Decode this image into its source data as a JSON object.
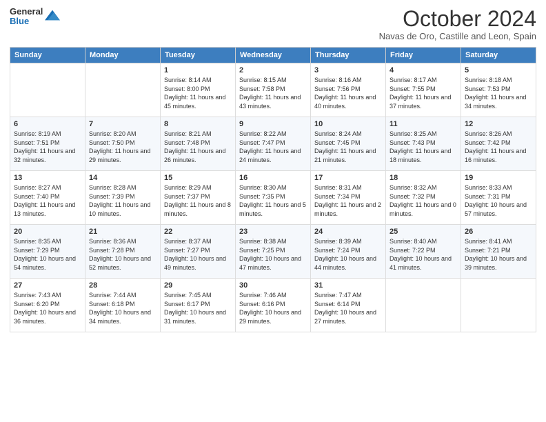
{
  "logo": {
    "general": "General",
    "blue": "Blue"
  },
  "header": {
    "month": "October 2024",
    "location": "Navas de Oro, Castille and Leon, Spain"
  },
  "weekdays": [
    "Sunday",
    "Monday",
    "Tuesday",
    "Wednesday",
    "Thursday",
    "Friday",
    "Saturday"
  ],
  "weeks": [
    [
      {
        "day": "",
        "content": ""
      },
      {
        "day": "",
        "content": ""
      },
      {
        "day": "1",
        "content": "Sunrise: 8:14 AM\nSunset: 8:00 PM\nDaylight: 11 hours and 45 minutes."
      },
      {
        "day": "2",
        "content": "Sunrise: 8:15 AM\nSunset: 7:58 PM\nDaylight: 11 hours and 43 minutes."
      },
      {
        "day": "3",
        "content": "Sunrise: 8:16 AM\nSunset: 7:56 PM\nDaylight: 11 hours and 40 minutes."
      },
      {
        "day": "4",
        "content": "Sunrise: 8:17 AM\nSunset: 7:55 PM\nDaylight: 11 hours and 37 minutes."
      },
      {
        "day": "5",
        "content": "Sunrise: 8:18 AM\nSunset: 7:53 PM\nDaylight: 11 hours and 34 minutes."
      }
    ],
    [
      {
        "day": "6",
        "content": "Sunrise: 8:19 AM\nSunset: 7:51 PM\nDaylight: 11 hours and 32 minutes."
      },
      {
        "day": "7",
        "content": "Sunrise: 8:20 AM\nSunset: 7:50 PM\nDaylight: 11 hours and 29 minutes."
      },
      {
        "day": "8",
        "content": "Sunrise: 8:21 AM\nSunset: 7:48 PM\nDaylight: 11 hours and 26 minutes."
      },
      {
        "day": "9",
        "content": "Sunrise: 8:22 AM\nSunset: 7:47 PM\nDaylight: 11 hours and 24 minutes."
      },
      {
        "day": "10",
        "content": "Sunrise: 8:24 AM\nSunset: 7:45 PM\nDaylight: 11 hours and 21 minutes."
      },
      {
        "day": "11",
        "content": "Sunrise: 8:25 AM\nSunset: 7:43 PM\nDaylight: 11 hours and 18 minutes."
      },
      {
        "day": "12",
        "content": "Sunrise: 8:26 AM\nSunset: 7:42 PM\nDaylight: 11 hours and 16 minutes."
      }
    ],
    [
      {
        "day": "13",
        "content": "Sunrise: 8:27 AM\nSunset: 7:40 PM\nDaylight: 11 hours and 13 minutes."
      },
      {
        "day": "14",
        "content": "Sunrise: 8:28 AM\nSunset: 7:39 PM\nDaylight: 11 hours and 10 minutes."
      },
      {
        "day": "15",
        "content": "Sunrise: 8:29 AM\nSunset: 7:37 PM\nDaylight: 11 hours and 8 minutes."
      },
      {
        "day": "16",
        "content": "Sunrise: 8:30 AM\nSunset: 7:35 PM\nDaylight: 11 hours and 5 minutes."
      },
      {
        "day": "17",
        "content": "Sunrise: 8:31 AM\nSunset: 7:34 PM\nDaylight: 11 hours and 2 minutes."
      },
      {
        "day": "18",
        "content": "Sunrise: 8:32 AM\nSunset: 7:32 PM\nDaylight: 11 hours and 0 minutes."
      },
      {
        "day": "19",
        "content": "Sunrise: 8:33 AM\nSunset: 7:31 PM\nDaylight: 10 hours and 57 minutes."
      }
    ],
    [
      {
        "day": "20",
        "content": "Sunrise: 8:35 AM\nSunset: 7:29 PM\nDaylight: 10 hours and 54 minutes."
      },
      {
        "day": "21",
        "content": "Sunrise: 8:36 AM\nSunset: 7:28 PM\nDaylight: 10 hours and 52 minutes."
      },
      {
        "day": "22",
        "content": "Sunrise: 8:37 AM\nSunset: 7:27 PM\nDaylight: 10 hours and 49 minutes."
      },
      {
        "day": "23",
        "content": "Sunrise: 8:38 AM\nSunset: 7:25 PM\nDaylight: 10 hours and 47 minutes."
      },
      {
        "day": "24",
        "content": "Sunrise: 8:39 AM\nSunset: 7:24 PM\nDaylight: 10 hours and 44 minutes."
      },
      {
        "day": "25",
        "content": "Sunrise: 8:40 AM\nSunset: 7:22 PM\nDaylight: 10 hours and 41 minutes."
      },
      {
        "day": "26",
        "content": "Sunrise: 8:41 AM\nSunset: 7:21 PM\nDaylight: 10 hours and 39 minutes."
      }
    ],
    [
      {
        "day": "27",
        "content": "Sunrise: 7:43 AM\nSunset: 6:20 PM\nDaylight: 10 hours and 36 minutes."
      },
      {
        "day": "28",
        "content": "Sunrise: 7:44 AM\nSunset: 6:18 PM\nDaylight: 10 hours and 34 minutes."
      },
      {
        "day": "29",
        "content": "Sunrise: 7:45 AM\nSunset: 6:17 PM\nDaylight: 10 hours and 31 minutes."
      },
      {
        "day": "30",
        "content": "Sunrise: 7:46 AM\nSunset: 6:16 PM\nDaylight: 10 hours and 29 minutes."
      },
      {
        "day": "31",
        "content": "Sunrise: 7:47 AM\nSunset: 6:14 PM\nDaylight: 10 hours and 27 minutes."
      },
      {
        "day": "",
        "content": ""
      },
      {
        "day": "",
        "content": ""
      }
    ]
  ]
}
